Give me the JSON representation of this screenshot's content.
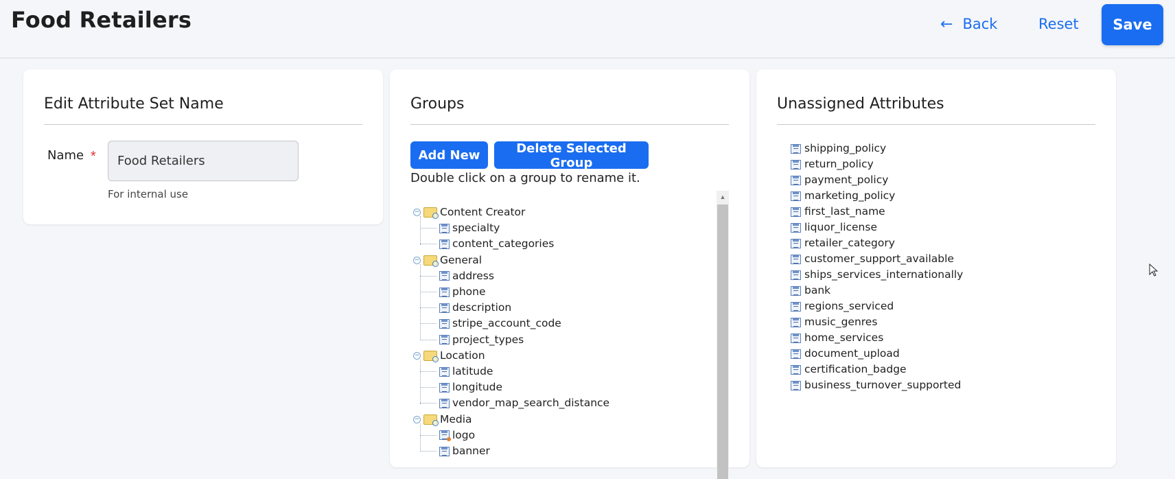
{
  "header": {
    "title": "Food Retailers",
    "back_label": "Back",
    "reset_label": "Reset",
    "save_label": "Save",
    "accent_color": "#1a6df0"
  },
  "edit_panel": {
    "title": "Edit Attribute Set Name",
    "name_label": "Name",
    "required_mark": "*",
    "name_value": "Food Retailers",
    "helper_text": "For internal use"
  },
  "groups_panel": {
    "title": "Groups",
    "add_new_label": "Add New",
    "delete_label": "Delete Selected Group",
    "hint": "Double click on a group to rename it.",
    "groups": [
      {
        "name": "Content Creator",
        "items": [
          "specialty",
          "content_categories"
        ]
      },
      {
        "name": "General",
        "items": [
          "address",
          "phone",
          "description",
          "stripe_account_code",
          "project_types"
        ]
      },
      {
        "name": "Location",
        "items": [
          "latitude",
          "longitude",
          "vendor_map_search_distance"
        ]
      },
      {
        "name": "Media",
        "items": [
          "logo",
          "banner"
        ]
      }
    ]
  },
  "unassigned_panel": {
    "title": "Unassigned Attributes",
    "items": [
      "shipping_policy",
      "return_policy",
      "payment_policy",
      "marketing_policy",
      "first_last_name",
      "liquor_license",
      "retailer_category",
      "customer_support_available",
      "ships_services_internationally",
      "bank",
      "regions_serviced",
      "music_genres",
      "home_services",
      "document_upload",
      "certification_badge",
      "business_turnover_supported"
    ]
  }
}
